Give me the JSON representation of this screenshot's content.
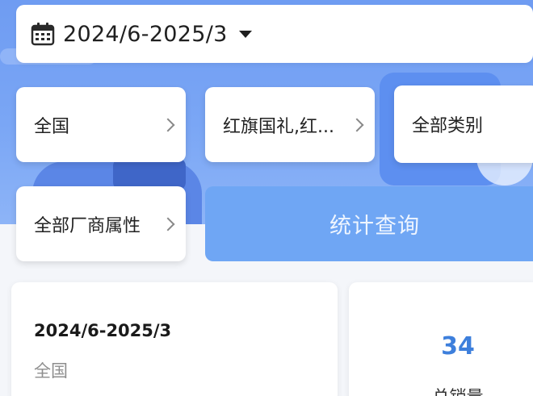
{
  "date_range": {
    "value": "2024/6-2025/3"
  },
  "filters": {
    "region": "全国",
    "brand": "红旗国礼,红...",
    "category": "全部类别",
    "vendor_attr": "全部厂商属性"
  },
  "query_button": {
    "label": "统计查询"
  },
  "summary_card": {
    "range": "2024/6-2025/3",
    "region": "全国"
  },
  "total_card": {
    "value": "34",
    "label": "总销量"
  },
  "colors": {
    "accent": "#6fa6f4",
    "number": "#3d7fdc",
    "hero": "#7aa6f5"
  }
}
